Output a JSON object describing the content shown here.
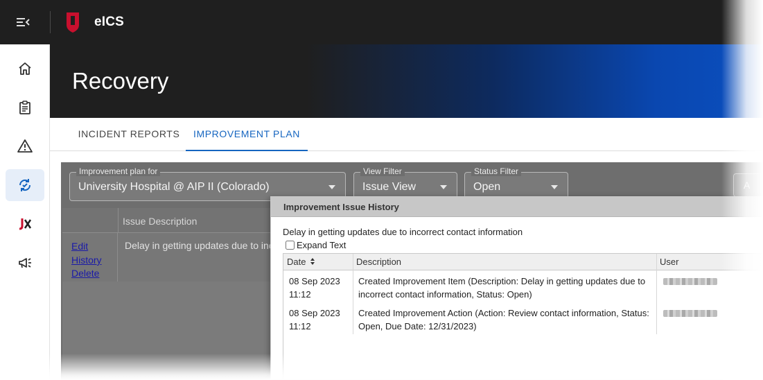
{
  "app": {
    "title": "eICS"
  },
  "icons": {
    "menu": "menu-collapse-icon",
    "logo": "eics-shield-logo",
    "nav": [
      "home-icon",
      "clipboard-icon",
      "warning-icon",
      "recovery-sync-icon",
      "jx-icon",
      "megaphone-icon"
    ]
  },
  "colors": {
    "accent": "#1565c0",
    "logo_red": "#c8102e",
    "active_nav_bg": "#e6eef9"
  },
  "page": {
    "title": "Recovery"
  },
  "tabs": [
    {
      "label": "INCIDENT REPORTS",
      "active": false
    },
    {
      "label": "IMPROVEMENT PLAN",
      "active": true
    }
  ],
  "filters": {
    "plan": {
      "label": "Improvement plan for",
      "value": "University Hospital @ AIP  II (Colorado)"
    },
    "view": {
      "label": "View Filter",
      "value": "Issue View"
    },
    "status": {
      "label": "Status Filter",
      "value": "Open"
    },
    "extra_button": "A"
  },
  "issues_list": {
    "column_header": "Issue Description",
    "row": {
      "links": [
        "Edit",
        "History",
        "Delete"
      ],
      "description": "Delay in getting updates due to incorrect contact information"
    }
  },
  "dialog": {
    "title": "Improvement Issue History",
    "issue": "Delay in getting updates due to incorrect contact information",
    "expand_text_label": "Expand Text",
    "columns": [
      "Date",
      "Description",
      "User"
    ],
    "rows": [
      {
        "date": "08 Sep 2023",
        "time": "11:12",
        "description": "Created Improvement Item (Description: Delay in getting updates due to incorrect contact information, Status: Open)"
      },
      {
        "date": "08 Sep 2023",
        "time": "11:12",
        "description": "Created Improvement Action (Action: Review contact information, Status: Open, Due Date: 12/31/2023)"
      }
    ]
  }
}
